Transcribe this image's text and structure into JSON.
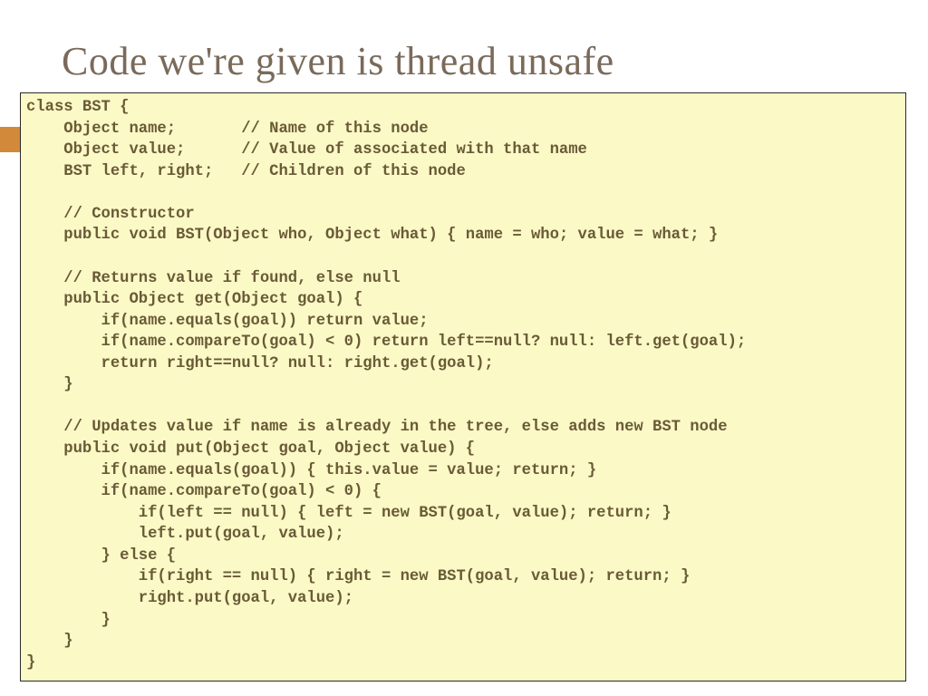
{
  "slide": {
    "title": "Code we're given is thread unsafe"
  },
  "code": {
    "lines": [
      "class BST {",
      "    Object name;       // Name of this node",
      "    Object value;      // Value of associated with that name",
      "    BST left, right;   // Children of this node",
      "",
      "    // Constructor",
      "    public void BST(Object who, Object what) { name = who; value = what; }",
      "",
      "    // Returns value if found, else null",
      "    public Object get(Object goal) {",
      "        if(name.equals(goal)) return value;",
      "        if(name.compareTo(goal) < 0) return left==null? null: left.get(goal);",
      "        return right==null? null: right.get(goal);",
      "    }",
      "",
      "    // Updates value if name is already in the tree, else adds new BST node",
      "    public void put(Object goal, Object value) {",
      "        if(name.equals(goal)) { this.value = value; return; }",
      "        if(name.compareTo(goal) < 0) {",
      "            if(left == null) { left = new BST(goal, value); return; }",
      "            left.put(goal, value);",
      "        } else {",
      "            if(right == null) { right = new BST(goal, value); return; }",
      "            right.put(goal, value);",
      "        }",
      "    }",
      "}"
    ]
  }
}
